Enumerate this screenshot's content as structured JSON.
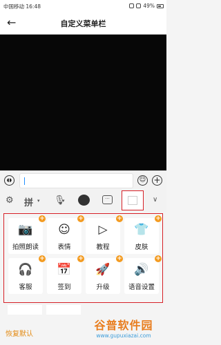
{
  "status": {
    "carrier_time": "中国移动 16:48",
    "battery": "49%"
  },
  "header": {
    "back": "←",
    "title": "自定义菜单栏"
  },
  "input_bar": {
    "voice_icon": "voice-wave-icon",
    "emoji_icon": "smiley-icon",
    "plus_icon": "plus-icon"
  },
  "toolbar": {
    "pinyin_label": "拼",
    "items": [
      "gear-icon",
      "pinyin-keyboard",
      "microphone-icon",
      "avatar-icon",
      "chat-icon",
      "empty-slot",
      "chevron-down-icon"
    ]
  },
  "grid": {
    "tiles": [
      {
        "label": "拍照朗读",
        "icon": "📷"
      },
      {
        "label": "表情",
        "icon": "☺"
      },
      {
        "label": "教程",
        "icon": "▷"
      },
      {
        "label": "皮肤",
        "icon": "👕"
      },
      {
        "label": "客服",
        "icon": "🎧"
      },
      {
        "label": "签到",
        "icon": "📅"
      },
      {
        "label": "升级",
        "icon": "🚀"
      },
      {
        "label": "语音设置",
        "icon": "🔊"
      }
    ],
    "badge": "+"
  },
  "footer": {
    "restore": "恢复默认"
  },
  "watermark": {
    "name": "谷普软件园",
    "url": "www.gupuxiazai.com"
  },
  "colors": {
    "accent": "#f39a1e",
    "highlight": "#d61f26"
  }
}
